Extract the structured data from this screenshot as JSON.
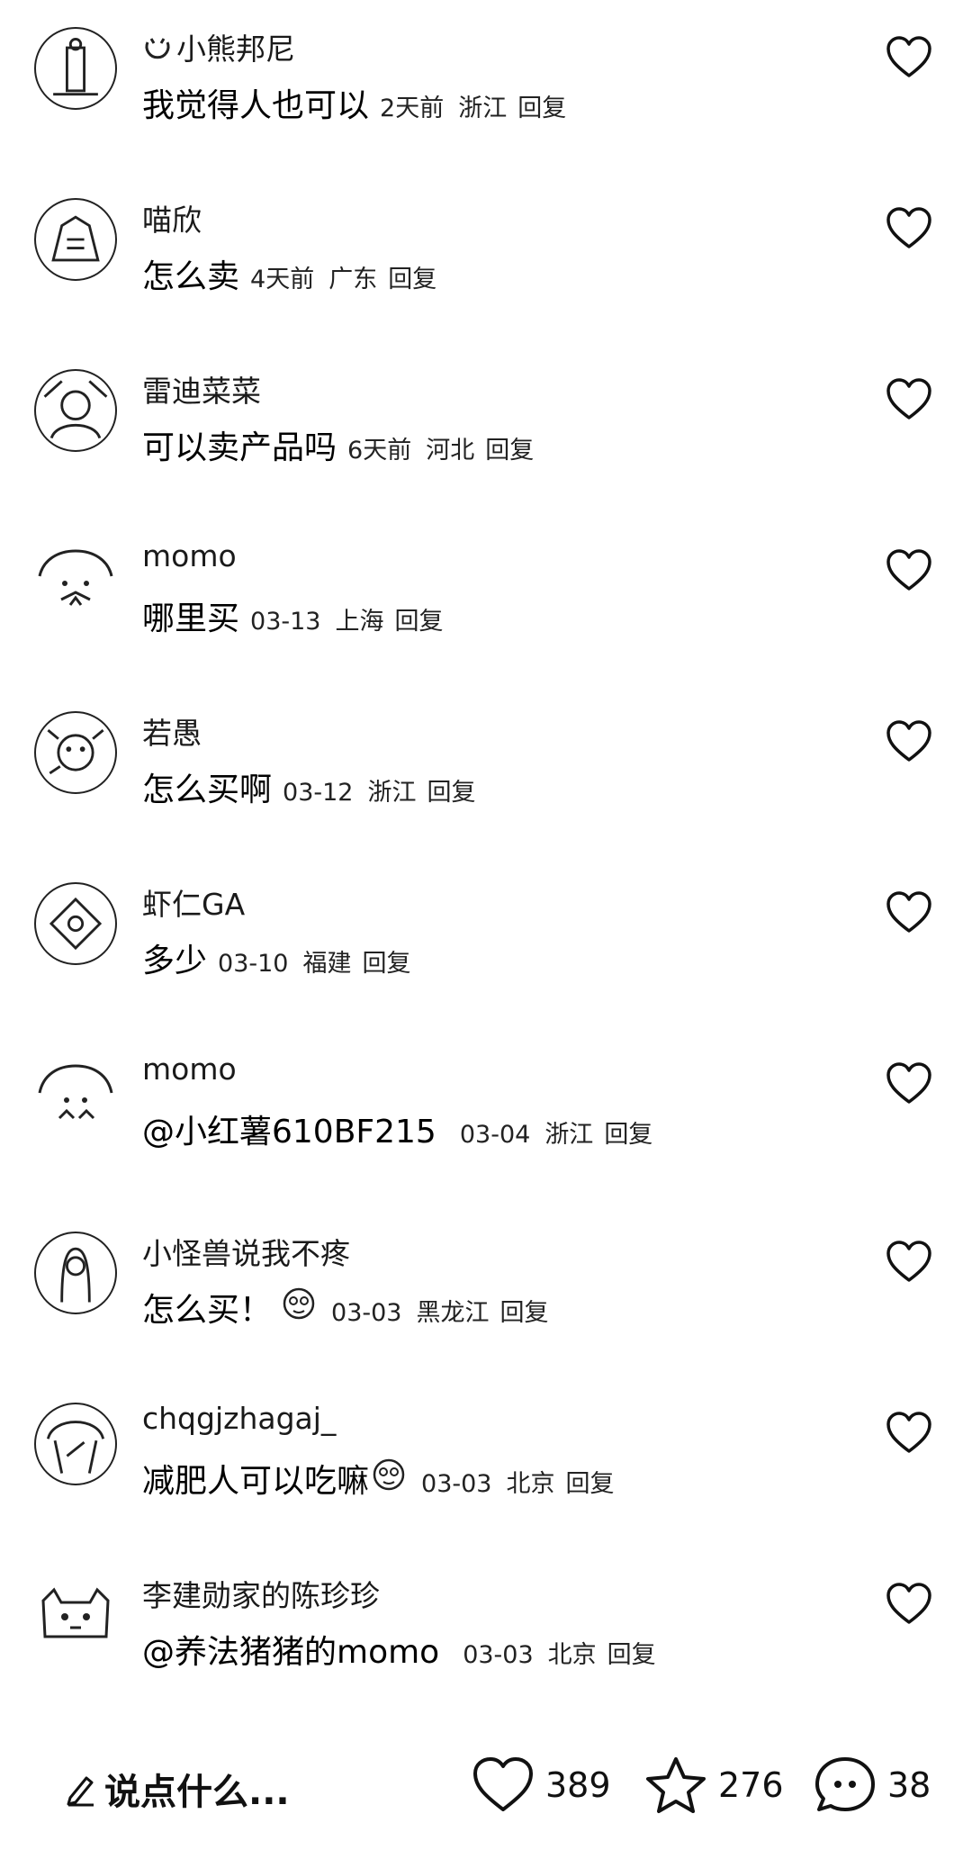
{
  "comments": [
    {
      "user": "小熊邦尼",
      "text": "我觉得人也可以",
      "time": "2天前",
      "location": "浙江",
      "reply": "回复"
    },
    {
      "user": "喵欣",
      "text": "怎么卖",
      "time": "4天前",
      "location": "广东",
      "reply": "回复"
    },
    {
      "user": "雷迪菜菜",
      "text": "可以卖产品吗",
      "time": "6天前",
      "location": "河北",
      "reply": "回复"
    },
    {
      "user": "momo",
      "text": "哪里买",
      "time": "03-13",
      "location": "上海",
      "reply": "回复"
    },
    {
      "user": "若愚",
      "text": "怎么买啊",
      "time": "03-12",
      "location": "浙江",
      "reply": "回复"
    },
    {
      "user": "虾仁GA",
      "text": "多少",
      "time": "03-10",
      "location": "福建",
      "reply": "回复"
    },
    {
      "user": "momo",
      "text": "@小红薯610BF215",
      "time": "03-04",
      "location": "浙江",
      "reply": "回复"
    },
    {
      "user": "小怪兽说我不疼",
      "text": "怎么买！",
      "time": "03-03",
      "location": "黑龙江",
      "reply": "回复",
      "emoji": "sticker-face-icon"
    },
    {
      "user": "chqgjzhagaj_",
      "text": "减肥人可以吃嘛",
      "time": "03-03",
      "location": "北京",
      "reply": "回复",
      "emoji": "sticker-face-icon"
    },
    {
      "user": "李建勋家的陈珍珍",
      "text": "@养法猪猪的momo",
      "time": "03-03",
      "location": "北京",
      "reply": "回复"
    }
  ],
  "bottom_bar": {
    "input_placeholder": "说点什么...",
    "likes": "389",
    "favorites": "276",
    "comments": "38",
    "icons": [
      "pencil-icon",
      "heart-icon",
      "star-icon",
      "chat-bubble-icon"
    ]
  }
}
